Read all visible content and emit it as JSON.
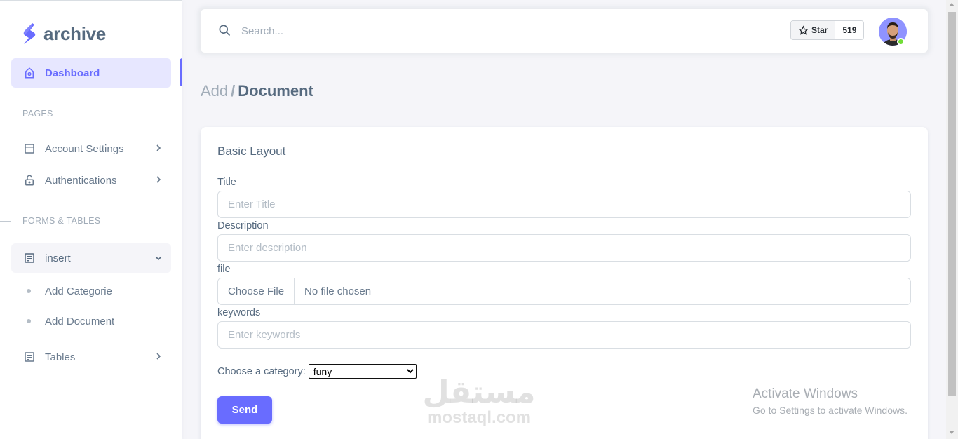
{
  "brand": {
    "name": "archive"
  },
  "sidebar": {
    "dashboard": "Dashboard",
    "header_pages": "PAGES",
    "account_settings": "Account Settings",
    "authentications": "Authentications",
    "header_forms": "FORMS & TABLES",
    "insert": "insert",
    "add_categorie": "Add Categorie",
    "add_document": "Add Document",
    "tables": "Tables"
  },
  "navbar": {
    "search_placeholder": "Search...",
    "star_label": "Star",
    "star_count": "519"
  },
  "breadcrumb": {
    "parent": "Add",
    "separator": "/",
    "current": "Document"
  },
  "card": {
    "title": "Basic Layout",
    "title_label": "Title",
    "title_placeholder": "Enter Title",
    "description_label": "Description",
    "description_placeholder": "Enter description",
    "file_label": "file",
    "file_button": "Choose File",
    "file_status": "No file chosen",
    "keywords_label": "keywords",
    "keywords_placeholder": "Enter keywords",
    "category_label": "Choose a category:",
    "category_selected": "funy",
    "send_label": "Send"
  },
  "watermark": {
    "arabic": "مستقل",
    "latin": "mostaql.com"
  },
  "os_notice": {
    "title": "Activate Windows",
    "subtitle": "Go to Settings to activate Windows."
  },
  "colors": {
    "primary": "#696cff",
    "online": "#71dd37"
  }
}
